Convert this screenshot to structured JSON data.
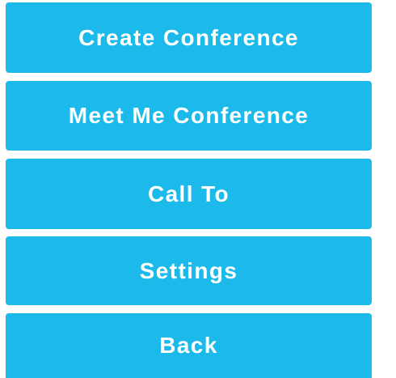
{
  "menu": {
    "buttons": [
      {
        "label": "Create Conference"
      },
      {
        "label": "Meet Me Conference"
      },
      {
        "label": "Call To"
      },
      {
        "label": "Settings"
      },
      {
        "label": "Back"
      }
    ]
  },
  "colors": {
    "button_background": "#1bbaea",
    "button_text": "#ffffff",
    "page_background": "#ffffff"
  }
}
